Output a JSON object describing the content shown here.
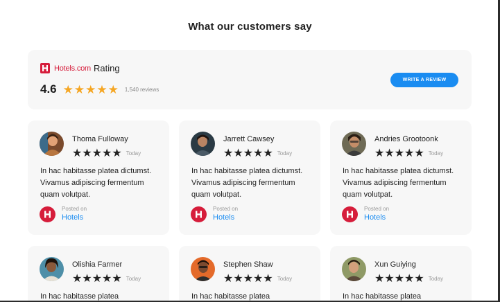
{
  "section": {
    "title": "What our customers say"
  },
  "summary": {
    "brand_name": "Hotels.com",
    "brand_label": "Rating",
    "average": "4.6",
    "stars": "★★★★★",
    "review_count": "1,540 reviews",
    "write_button": "WRITE A REVIEW"
  },
  "reviews": [
    {
      "name": "Thoma Fulloway",
      "stars": "★★★★★",
      "rating": 5,
      "date": "Today",
      "text": "In hac habitasse platea dictumst. Vivamus adipiscing fermentum quam volutpat.",
      "posted_label": "Posted on",
      "posted_site": "Hotels"
    },
    {
      "name": "Jarrett Cawsey",
      "stars": "★★★★★",
      "rating": 5,
      "date": "Today",
      "text": "In hac habitasse platea dictumst. Vivamus adipiscing fermentum quam volutpat.",
      "posted_label": "Posted on",
      "posted_site": "Hotels"
    },
    {
      "name": "Andries Grootoonk",
      "stars": "★★★★★",
      "rating": 5,
      "date": "Today",
      "text": "In hac habitasse platea dictumst. Vivamus adipiscing fermentum quam volutpat.",
      "posted_label": "Posted on",
      "posted_site": "Hotels"
    },
    {
      "name": "Olishia Farmer",
      "stars": "★★★★★",
      "rating": 5,
      "date": "Today",
      "text": "In hac habitasse platea",
      "posted_label": "",
      "posted_site": ""
    },
    {
      "name": "Stephen Shaw",
      "stars": "★★★★★",
      "rating": 5,
      "date": "Today",
      "text": "In hac habitasse platea",
      "posted_label": "",
      "posted_site": ""
    },
    {
      "name": "Xun Guiying",
      "stars": "★★★★★",
      "rating": 5,
      "date": "Today",
      "text": "In hac habitasse platea",
      "posted_label": "",
      "posted_site": ""
    }
  ],
  "colors": {
    "accent": "#1a8cf1",
    "brand": "#d61d3b",
    "star": "#f5a623",
    "card_bg": "#f7f7f7"
  },
  "icons": {
    "brand": "hotels-logo-icon",
    "source": "hotels-badge-icon",
    "star": "star-icon"
  }
}
